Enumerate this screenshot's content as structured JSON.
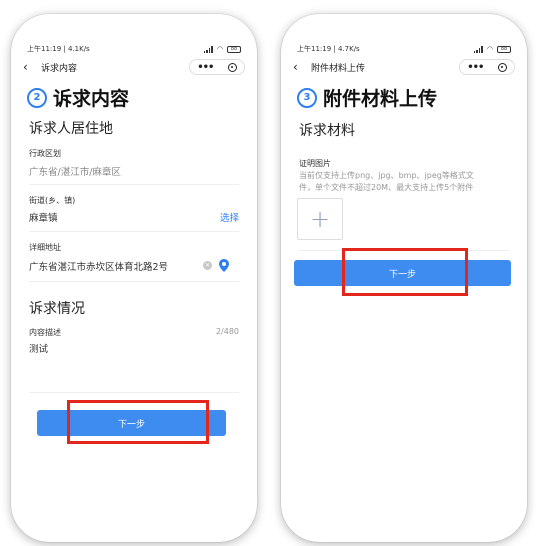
{
  "left": {
    "status": {
      "time": "上午11:19 | 4.1K/s",
      "battery": "88"
    },
    "nav": {
      "title": "诉求内容"
    },
    "step": {
      "number": "2",
      "title": "诉求内容"
    },
    "residence": {
      "section_title": "诉求人居住地",
      "district_label": "行政区划",
      "district_value": "广东省/湛江市/麻章区",
      "street_label": "街道(乡、镇)",
      "street_value": "麻章镇",
      "street_action": "选择",
      "address_label": "详细地址",
      "address_value": "广东省湛江市赤坎区体育北路2号"
    },
    "situation": {
      "section_title": "诉求情况",
      "desc_label": "内容描述",
      "desc_counter": "2/480",
      "desc_value": "测试"
    },
    "next_button": "下一步"
  },
  "right": {
    "status": {
      "time": "上午11:19 | 4.7K/s",
      "battery": "88"
    },
    "nav": {
      "title": "附件材料上传"
    },
    "step": {
      "number": "3",
      "title": "附件材料上传"
    },
    "materials": {
      "section_title": "诉求材料",
      "photo_label": "证明图片",
      "hint_line1": "当前仅支持上传png、jpg、bmp、jpeg等格式文",
      "hint_line2": "件，单个文件不超过20M、最大支持上传5个附件",
      "upload_symbol": "+"
    },
    "next_button": "下一步"
  },
  "colors": {
    "accent": "#2f7ff0",
    "button": "#3f8cf0",
    "highlight": "#e2261c"
  }
}
